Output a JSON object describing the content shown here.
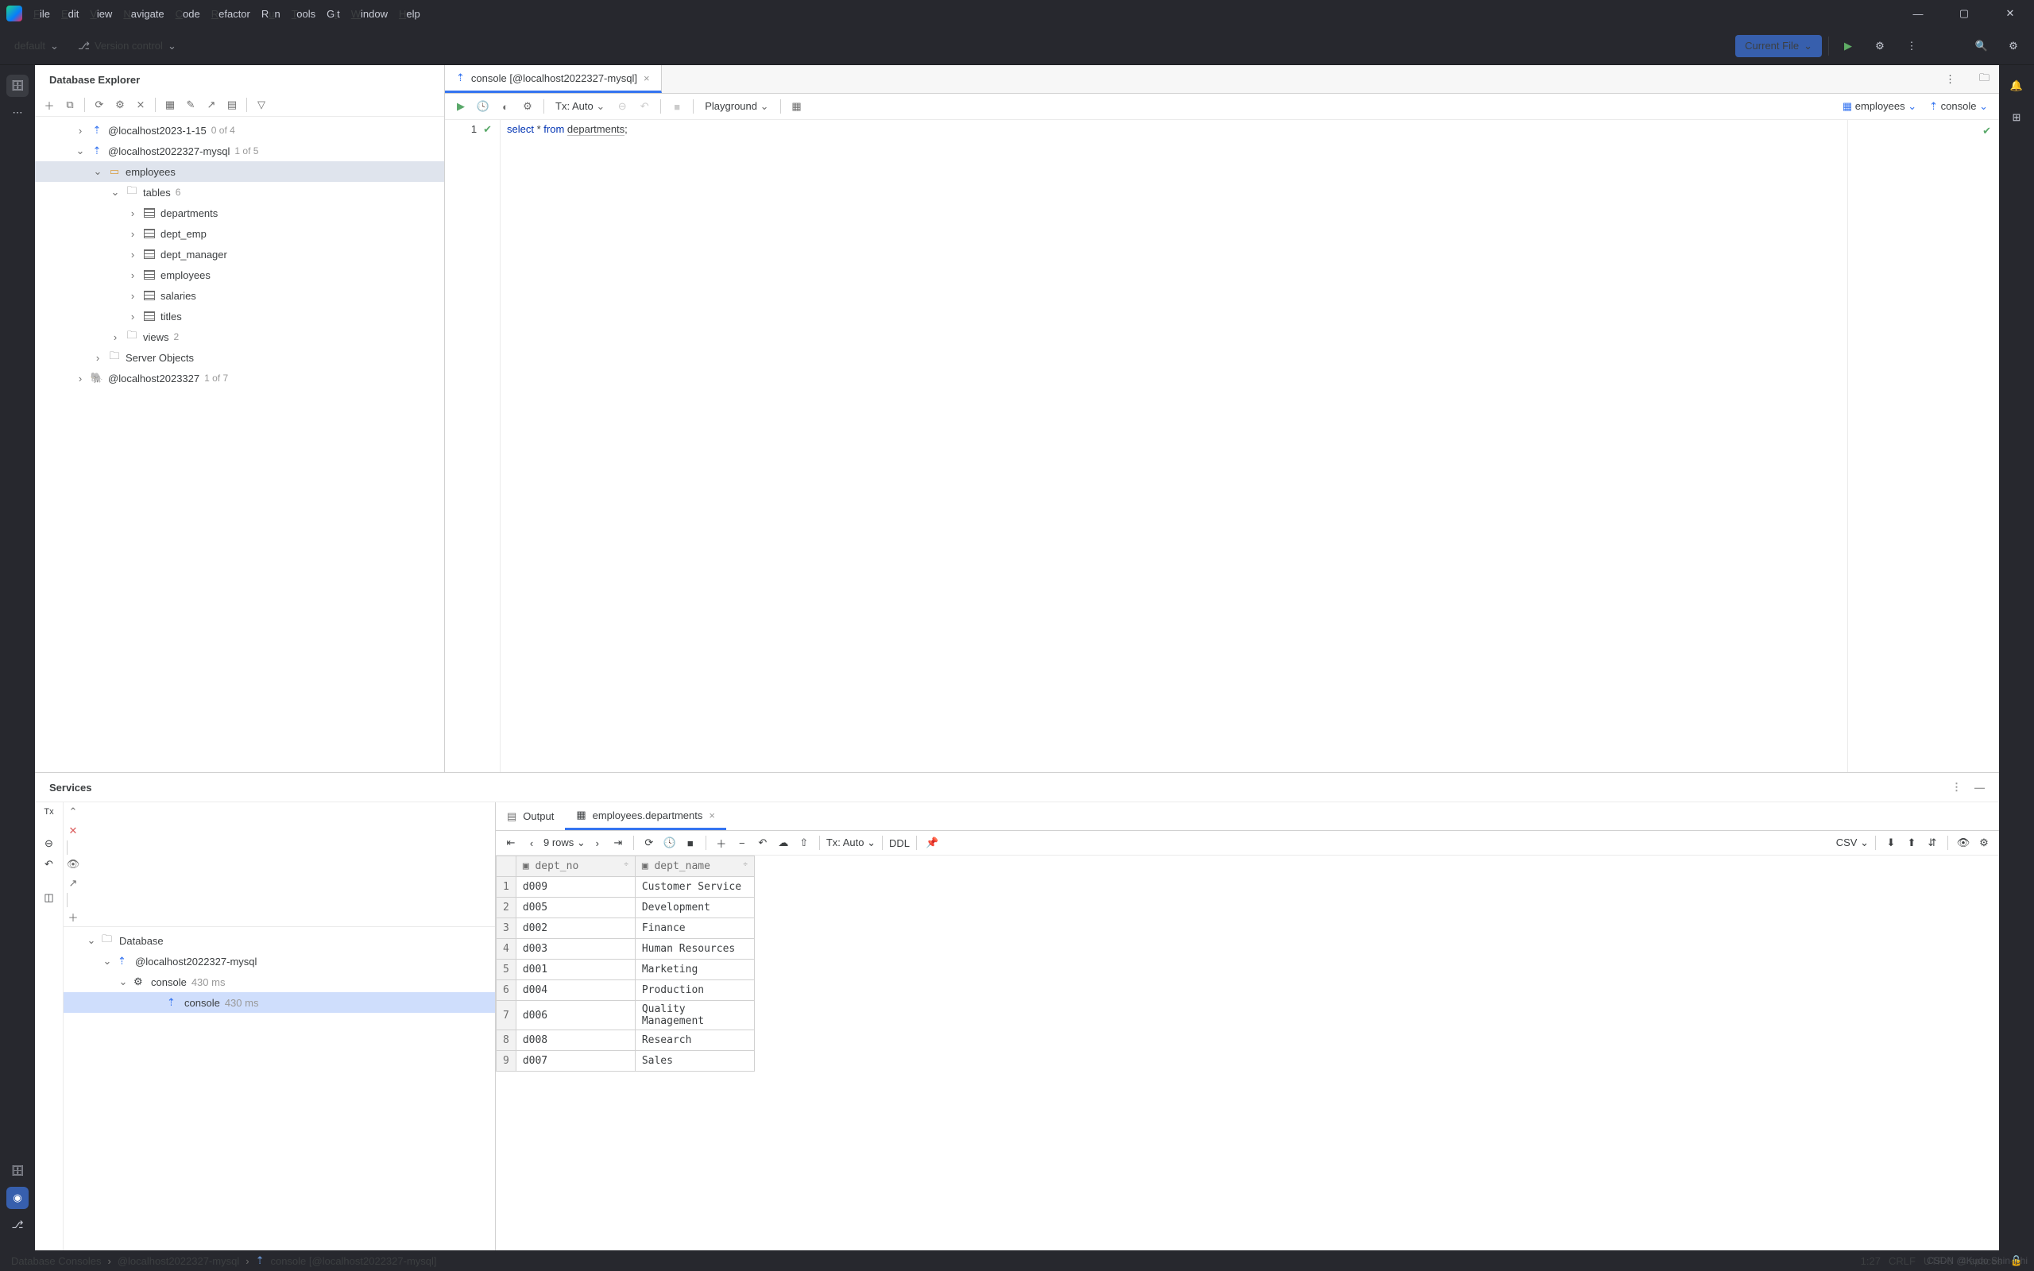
{
  "menu": [
    "File",
    "Edit",
    "View",
    "Navigate",
    "Code",
    "Refactor",
    "Run",
    "Tools",
    "Git",
    "Window",
    "Help"
  ],
  "menuUL": [
    "F",
    "E",
    "V",
    "N",
    "C",
    "R",
    "R",
    "T",
    "G",
    "W",
    "H"
  ],
  "nav": {
    "project": "default",
    "vcs": "Version control",
    "currentFile": "Current File"
  },
  "dbexp": {
    "title": "Database Explorer",
    "nodes": [
      {
        "pad": 50,
        "arrow": "›",
        "icon": "console",
        "label": "@localhost2023-1-15",
        "sub": "0 of 4"
      },
      {
        "pad": 50,
        "arrow": "⌄",
        "icon": "console",
        "label": "@localhost2022327-mysql",
        "sub": "1 of 5"
      },
      {
        "pad": 72,
        "arrow": "⌄",
        "icon": "schema",
        "label": "employees",
        "sel": true
      },
      {
        "pad": 94,
        "arrow": "⌄",
        "icon": "folder",
        "label": "tables",
        "sub": "6"
      },
      {
        "pad": 116,
        "arrow": "›",
        "icon": "table",
        "label": "departments"
      },
      {
        "pad": 116,
        "arrow": "›",
        "icon": "table",
        "label": "dept_emp"
      },
      {
        "pad": 116,
        "arrow": "›",
        "icon": "table",
        "label": "dept_manager"
      },
      {
        "pad": 116,
        "arrow": "›",
        "icon": "table",
        "label": "employees"
      },
      {
        "pad": 116,
        "arrow": "›",
        "icon": "table",
        "label": "salaries"
      },
      {
        "pad": 116,
        "arrow": "›",
        "icon": "table",
        "label": "titles"
      },
      {
        "pad": 94,
        "arrow": "›",
        "icon": "folder",
        "label": "views",
        "sub": "2"
      },
      {
        "pad": 72,
        "arrow": "›",
        "icon": "folder",
        "label": "Server Objects"
      },
      {
        "pad": 50,
        "arrow": "›",
        "icon": "pg",
        "label": "@localhost2023327",
        "sub": "1 of 7"
      }
    ]
  },
  "editor": {
    "tab": "console [@localhost2022327-mysql]",
    "tx": "Tx: Auto",
    "playground": "Playground",
    "right": {
      "schema": "employees",
      "target": "console"
    },
    "line": "1",
    "sql": {
      "kw1": "select",
      "star": "*",
      "kw2": "from",
      "tbl": "departments",
      "end": ";"
    }
  },
  "services": {
    "title": "Services",
    "tree": [
      {
        "pad": 28,
        "arrow": "⌄",
        "icon": "folder",
        "label": "Database"
      },
      {
        "pad": 48,
        "arrow": "⌄",
        "icon": "console",
        "label": "@localhost2022327-mysql"
      },
      {
        "pad": 68,
        "arrow": "⌄",
        "icon": "cog",
        "label": "console",
        "sub": "430 ms"
      },
      {
        "pad": 110,
        "arrow": "",
        "icon": "query",
        "label": "console",
        "sub": "430 ms",
        "sel": true
      }
    ],
    "tabs": {
      "output": "Output",
      "result": "employees.departments"
    },
    "rows": "9 rows",
    "tx": "Tx: Auto",
    "ddl": "DDL",
    "csv": "CSV",
    "cols": [
      "dept_no",
      "dept_name"
    ],
    "data": [
      [
        "d009",
        "Customer Service"
      ],
      [
        "d005",
        "Development"
      ],
      [
        "d002",
        "Finance"
      ],
      [
        "d003",
        "Human Resources"
      ],
      [
        "d001",
        "Marketing"
      ],
      [
        "d004",
        "Production"
      ],
      [
        "d006",
        "Quality Management"
      ],
      [
        "d008",
        "Research"
      ],
      [
        "d007",
        "Sales"
      ]
    ]
  },
  "breadcrumbs": [
    "Database Consoles",
    "@localhost2022327-mysql",
    "console [@localhost2022327-mysql]"
  ],
  "status": {
    "pos": "1:27",
    "eol": "CRLF",
    "enc": "UTF-8",
    "indent": "4 spaces"
  },
  "watermark": "CSDN @Kudo Shin-ichi"
}
